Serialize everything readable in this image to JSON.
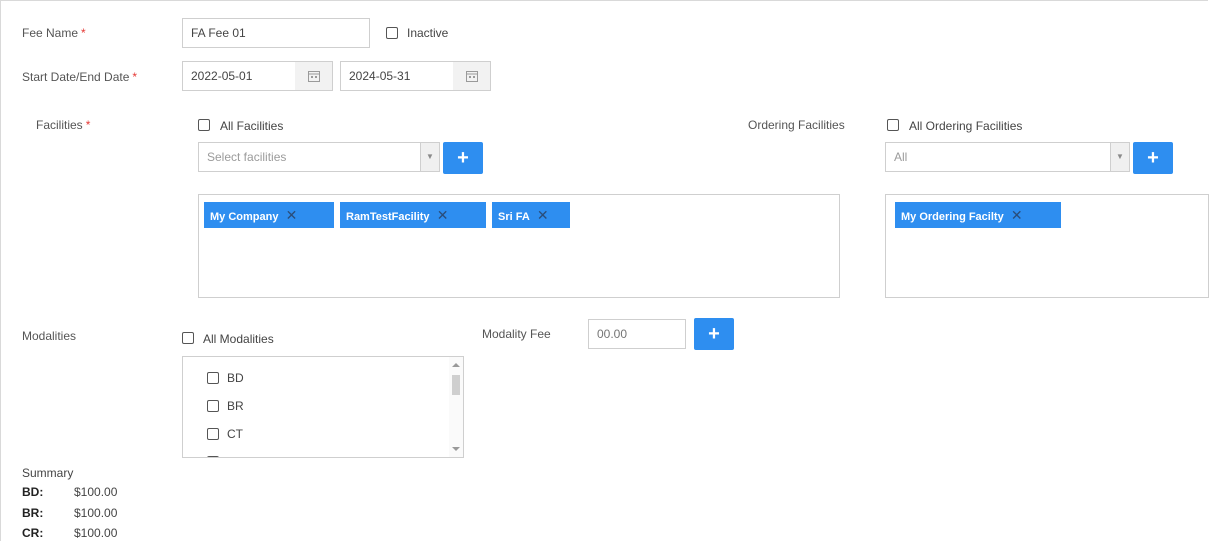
{
  "fee_name": {
    "label": "Fee Name",
    "value": "FA Fee 01"
  },
  "inactive": {
    "label": "Inactive"
  },
  "dates": {
    "label": "Start Date/End Date",
    "start": "2022-05-01",
    "end": "2024-05-31"
  },
  "required_mark": "*",
  "facilities": {
    "label": "Facilities",
    "all_label": "All Facilities",
    "select_placeholder": "Select facilities",
    "tags": [
      "My Company",
      "RamTestFacility",
      "Sri FA"
    ]
  },
  "ordering_facilities": {
    "label": "Ordering Facilities",
    "all_label": "All Ordering Facilities",
    "select_value": "All",
    "tags": [
      "My Ordering Facilty"
    ]
  },
  "modalities": {
    "label": "Modalities",
    "all_label": "All Modalities",
    "items": [
      "BD",
      "BR",
      "CT"
    ]
  },
  "modality_fee": {
    "label": "Modality Fee",
    "placeholder": "00.00"
  },
  "add_symbol": "+",
  "remove_symbol": "✕",
  "summary": {
    "title": "Summary",
    "rows": [
      {
        "code": "BD:",
        "amount": "$100.00"
      },
      {
        "code": "BR:",
        "amount": "$100.00"
      },
      {
        "code": "CR:",
        "amount": "$100.00"
      }
    ]
  },
  "colors": {
    "accent": "#2e8ef0",
    "required": "#e53935"
  }
}
